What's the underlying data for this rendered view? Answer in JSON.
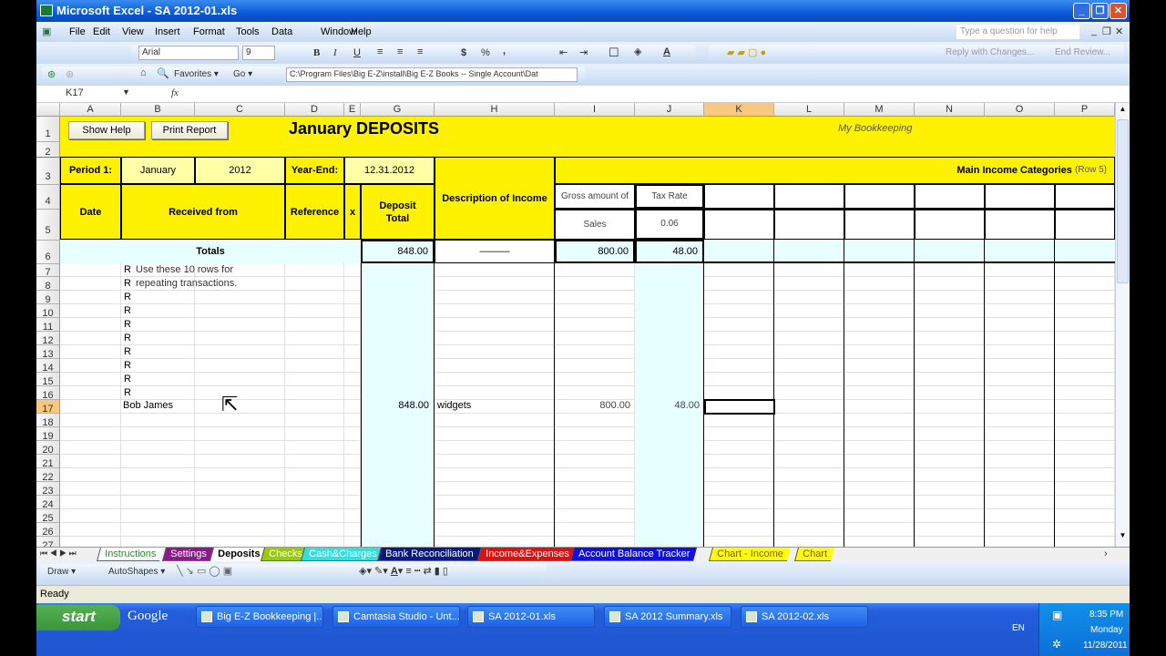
{
  "window": {
    "title": "Microsoft Excel - SA 2012-01.xls"
  },
  "menu": [
    "File",
    "Edit",
    "View",
    "Insert",
    "Format",
    "Tools",
    "Data",
    "Window",
    "Help"
  ],
  "help_placeholder": "Type a question for help",
  "format_toolbar": {
    "font": "Arial",
    "size": "9",
    "bold": "B",
    "italic": "I",
    "underline": "U",
    "currency": "$",
    "percent": "%",
    "comma": ","
  },
  "reviewing": {
    "reply": "Reply with Changes...",
    "end": "End Review..."
  },
  "web_toolbar": {
    "favorites": "Favorites",
    "go": "Go",
    "address": "C:\\Program Files\\Big E-Z\\install\\Big E-Z Books -- Single Account\\Dat"
  },
  "formula_bar": {
    "name_box": "K17",
    "fx": "fx",
    "value": ""
  },
  "columns": [
    "A",
    "B",
    "C",
    "D",
    "E",
    "G",
    "H",
    "I",
    "J",
    "K",
    "L",
    "M",
    "N",
    "O",
    "P"
  ],
  "selected_column": "K",
  "rows": [
    "1",
    "2",
    "3",
    "4",
    "5",
    "6",
    "7",
    "8",
    "9",
    "10",
    "11",
    "12",
    "13",
    "14",
    "15",
    "16",
    "17",
    "18",
    "19",
    "20",
    "21",
    "22",
    "23",
    "24",
    "25",
    "26",
    "27"
  ],
  "selected_row": "17",
  "sheet": {
    "show_help": "Show Help",
    "print_report": "Print Report",
    "title": "January DEPOSITS",
    "my_bookkeeping": "My Bookkeeping",
    "period_label": "Period 1:",
    "period_month": "January",
    "period_year": "2012",
    "year_end_label": "Year-End:",
    "year_end": "12.31.2012",
    "main_income": "Main  Income Categories",
    "main_income_note": "(Row 5)",
    "h_date": "Date",
    "h_received": "Received from",
    "h_reference": "Reference",
    "h_x": "x",
    "h_deposit": "Deposit Total",
    "h_description": "Description of Income",
    "h_gross": "Gross amount of",
    "h_tax": "Tax Rate",
    "cat_sales": "Sales",
    "tax_rate": "0.06",
    "totals_label": "Totals",
    "total_deposit": "848.00",
    "total_desc": "———",
    "total_sales": "800.00",
    "total_tax": "48.00",
    "r_marks": [
      "R",
      "R",
      "R",
      "R",
      "R",
      "R",
      "R",
      "R",
      "R",
      "R"
    ],
    "note1": "Use these 10 rows for",
    "note2": "repeating transactions.",
    "entry": {
      "received": "Bob James",
      "deposit": "848.00",
      "description": "widgets",
      "sales": "800.00",
      "tax": "48.00"
    }
  },
  "sheet_tabs": [
    {
      "label": "Instructions",
      "bg": "#ffffff",
      "fg": "#2a8a2a"
    },
    {
      "label": "Settings",
      "bg": "#8b1a8b",
      "fg": "#ffffff"
    },
    {
      "label": "Deposits",
      "bg": "#ffffff",
      "fg": "#000000",
      "active": true
    },
    {
      "label": "Checks",
      "bg": "#99cc00",
      "fg": "#ffffff"
    },
    {
      "label": "Cash&Charges",
      "bg": "#33e0e0",
      "fg": "#ffffff"
    },
    {
      "label": "Bank Reconciliation",
      "bg": "#0a1a80",
      "fg": "#ffffff"
    },
    {
      "label": "Income&Expenses",
      "bg": "#e01010",
      "fg": "#ffffff"
    },
    {
      "label": "Account Balance Tracker",
      "bg": "#1010e0",
      "fg": "#ffffff"
    },
    {
      "label": "Chart - Income",
      "bg": "#ffff00",
      "fg": "#806000"
    },
    {
      "label": "Chart",
      "bg": "#ffff00",
      "fg": "#806000"
    }
  ],
  "drawing": {
    "draw": "Draw",
    "autoshapes": "AutoShapes"
  },
  "status": "Ready",
  "taskbar": {
    "start": "start",
    "google": "Google",
    "tasks": [
      "Big E-Z Bookkeeping |...",
      "Camtasia Studio - Unt...",
      "SA 2012-01.xls",
      "SA 2012 Summary.xls",
      "SA 2012-02.xls"
    ],
    "lang": "EN",
    "time": "8:35 PM",
    "day": "Monday",
    "date": "11/28/2011"
  }
}
